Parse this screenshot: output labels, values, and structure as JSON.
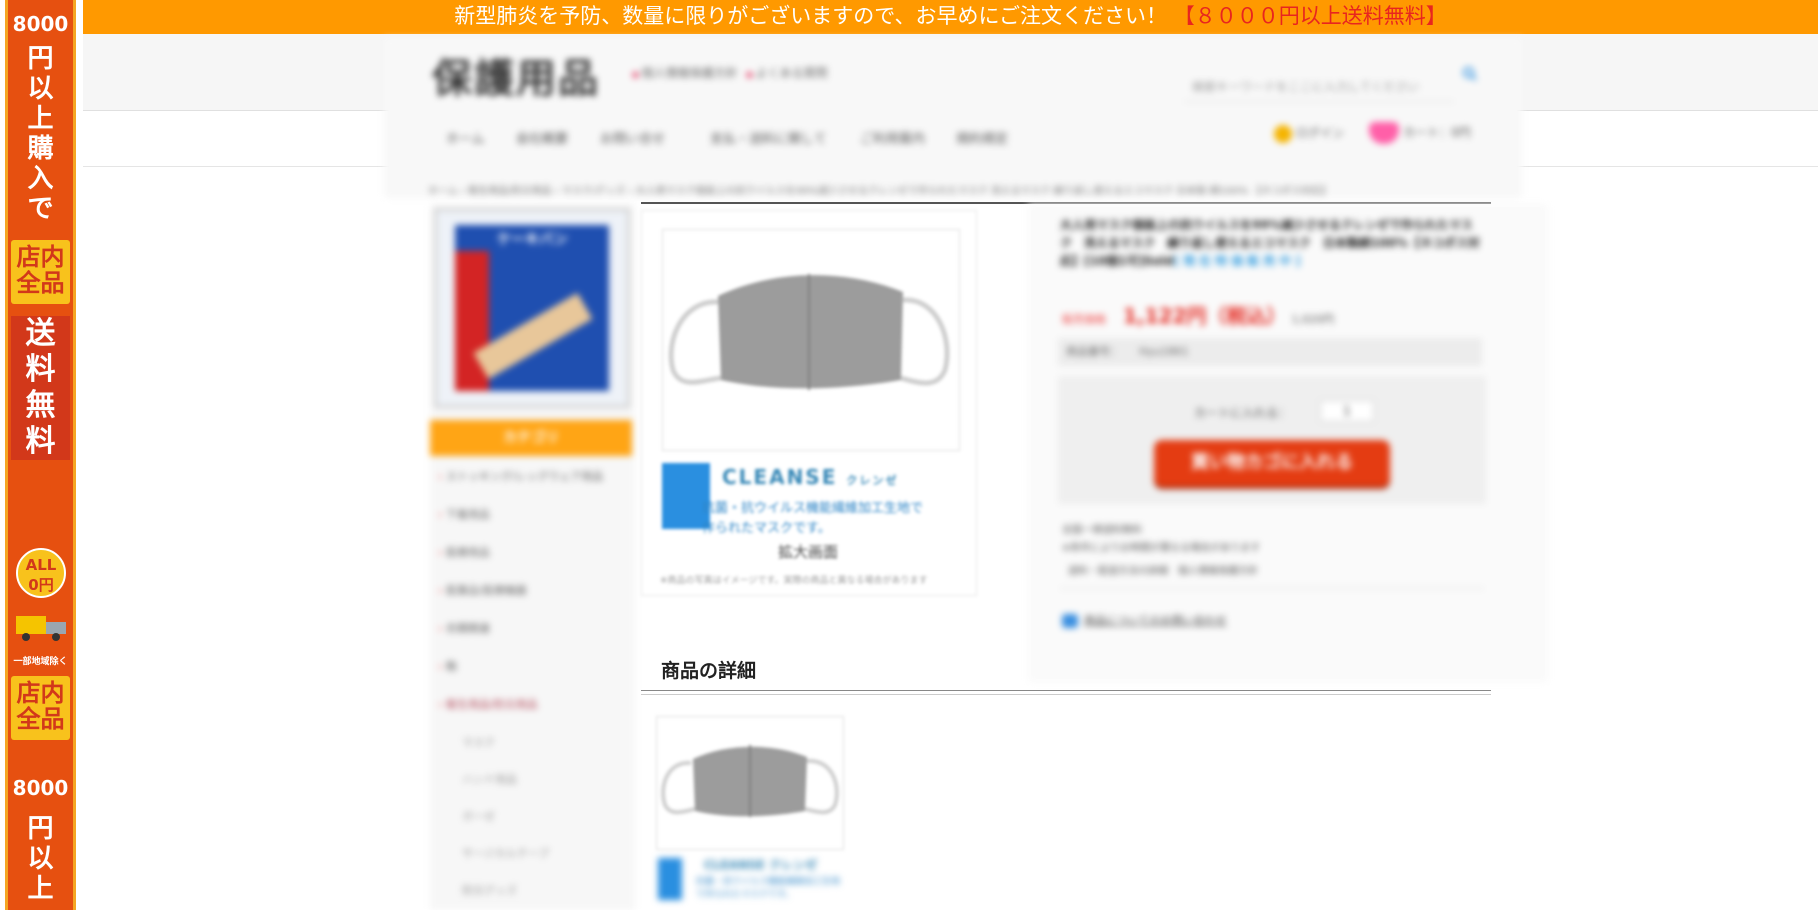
{
  "side_banner": {
    "amount": "8000",
    "text_top": [
      "円",
      "以",
      "上",
      "購",
      "入",
      "で"
    ],
    "store_all": "店内全品",
    "free_shipping": [
      "送",
      "料",
      "無",
      "料"
    ],
    "all_label": "ALL",
    "zero_label": "0円",
    "region_note": "一部地域除く",
    "store_all_2": "店内全品",
    "amount_2": "8000",
    "text_bottom": [
      "円",
      "以",
      "上"
    ]
  },
  "top_bar": {
    "message": "新型肺炎を予防、数量に限りがございますので、お早めにご注文ください！",
    "promo": "【８０００円以上送料無料】"
  },
  "header": {
    "logo": "保護用品",
    "link_1": "個人情報保護方針",
    "link_2": "よくある質問",
    "search_placeholder": "検索キーワードをここに入力してください",
    "nav": [
      "ホーム",
      "会社概要",
      "お問い合せ",
      "支払・送料に関して",
      "ご利用案内",
      "規約規定"
    ],
    "login": "ログイン",
    "cart": "カート：0円",
    "breadcrumb": "ホーム › 衛生用品/防災用品 › マスク/グッズ › 大人用マスク個装上の抗ウイルスを99%減少させるクレンゼで作られたマスク 洗えるマスク 繰り返し使えるエコマスク 日本製 綿100% 【ネコポス対応】"
  },
  "sidebar": {
    "category_header": "カテゴリ",
    "categories": [
      "ストッキング/レッグウェア用品",
      "下着用品",
      "医療用品",
      "医薬品/医療機器",
      "衣類関連",
      "鞄",
      "衛生用品/防災用品"
    ],
    "sub_categories": [
      "マスク",
      "ハンド用品",
      "ガーゼ",
      "サージカルテープ",
      "防災グッズ"
    ],
    "banner_title": "ケーキバン"
  },
  "product": {
    "maker_name": "CLEANSE",
    "maker_kana": "クレンゼ",
    "maker_desc": "抗菌・抗ウイルス機能繊維加工生地で作られたマスクです。",
    "zoom_label": "拡大画面",
    "zoom_note": "※商品の写真はイメージです。実際の商品と異なる場合があります",
    "title": "大人用マスク個装上の抗ウイルスを99%減少させるクレンゼで作られたマスク　洗えるマスク　繰り返し使えるエコマスク　日本製綿100%【ネコポス対応】[10個1可]Sold",
    "stock_badge": "[現在特価販売中]",
    "price_label": "販売価格",
    "price": "1,122円（税込）",
    "price_tax": "1,020円",
    "code_label": "商品番号：",
    "code_value": "Hyu1861",
    "qty_label": "カートに入れる：",
    "qty_value": "1",
    "add_to_cart": "買い物カゴに入れる",
    "ship_line_1": "全国一律送料無料",
    "ship_line_2": "※条件によりお時間が異なる場合があります",
    "ship_link": "送料・配送方法の詳細　個人情報保護方針",
    "inquiry": "商品についてのお問い合わせ"
  },
  "details": {
    "heading": "商品の詳細",
    "maker_name": "CLEANSE クレンゼ",
    "maker_desc": "抗菌・抗ウイルス機能繊維加工生地で作られたマスクです。"
  },
  "colors": {
    "top_bar": "#ff9900",
    "promo": "#e8251f",
    "side_banner": "#e65010",
    "category_header": "#ffa515",
    "cart_button": "#e43c12",
    "price": "#e4251c"
  }
}
